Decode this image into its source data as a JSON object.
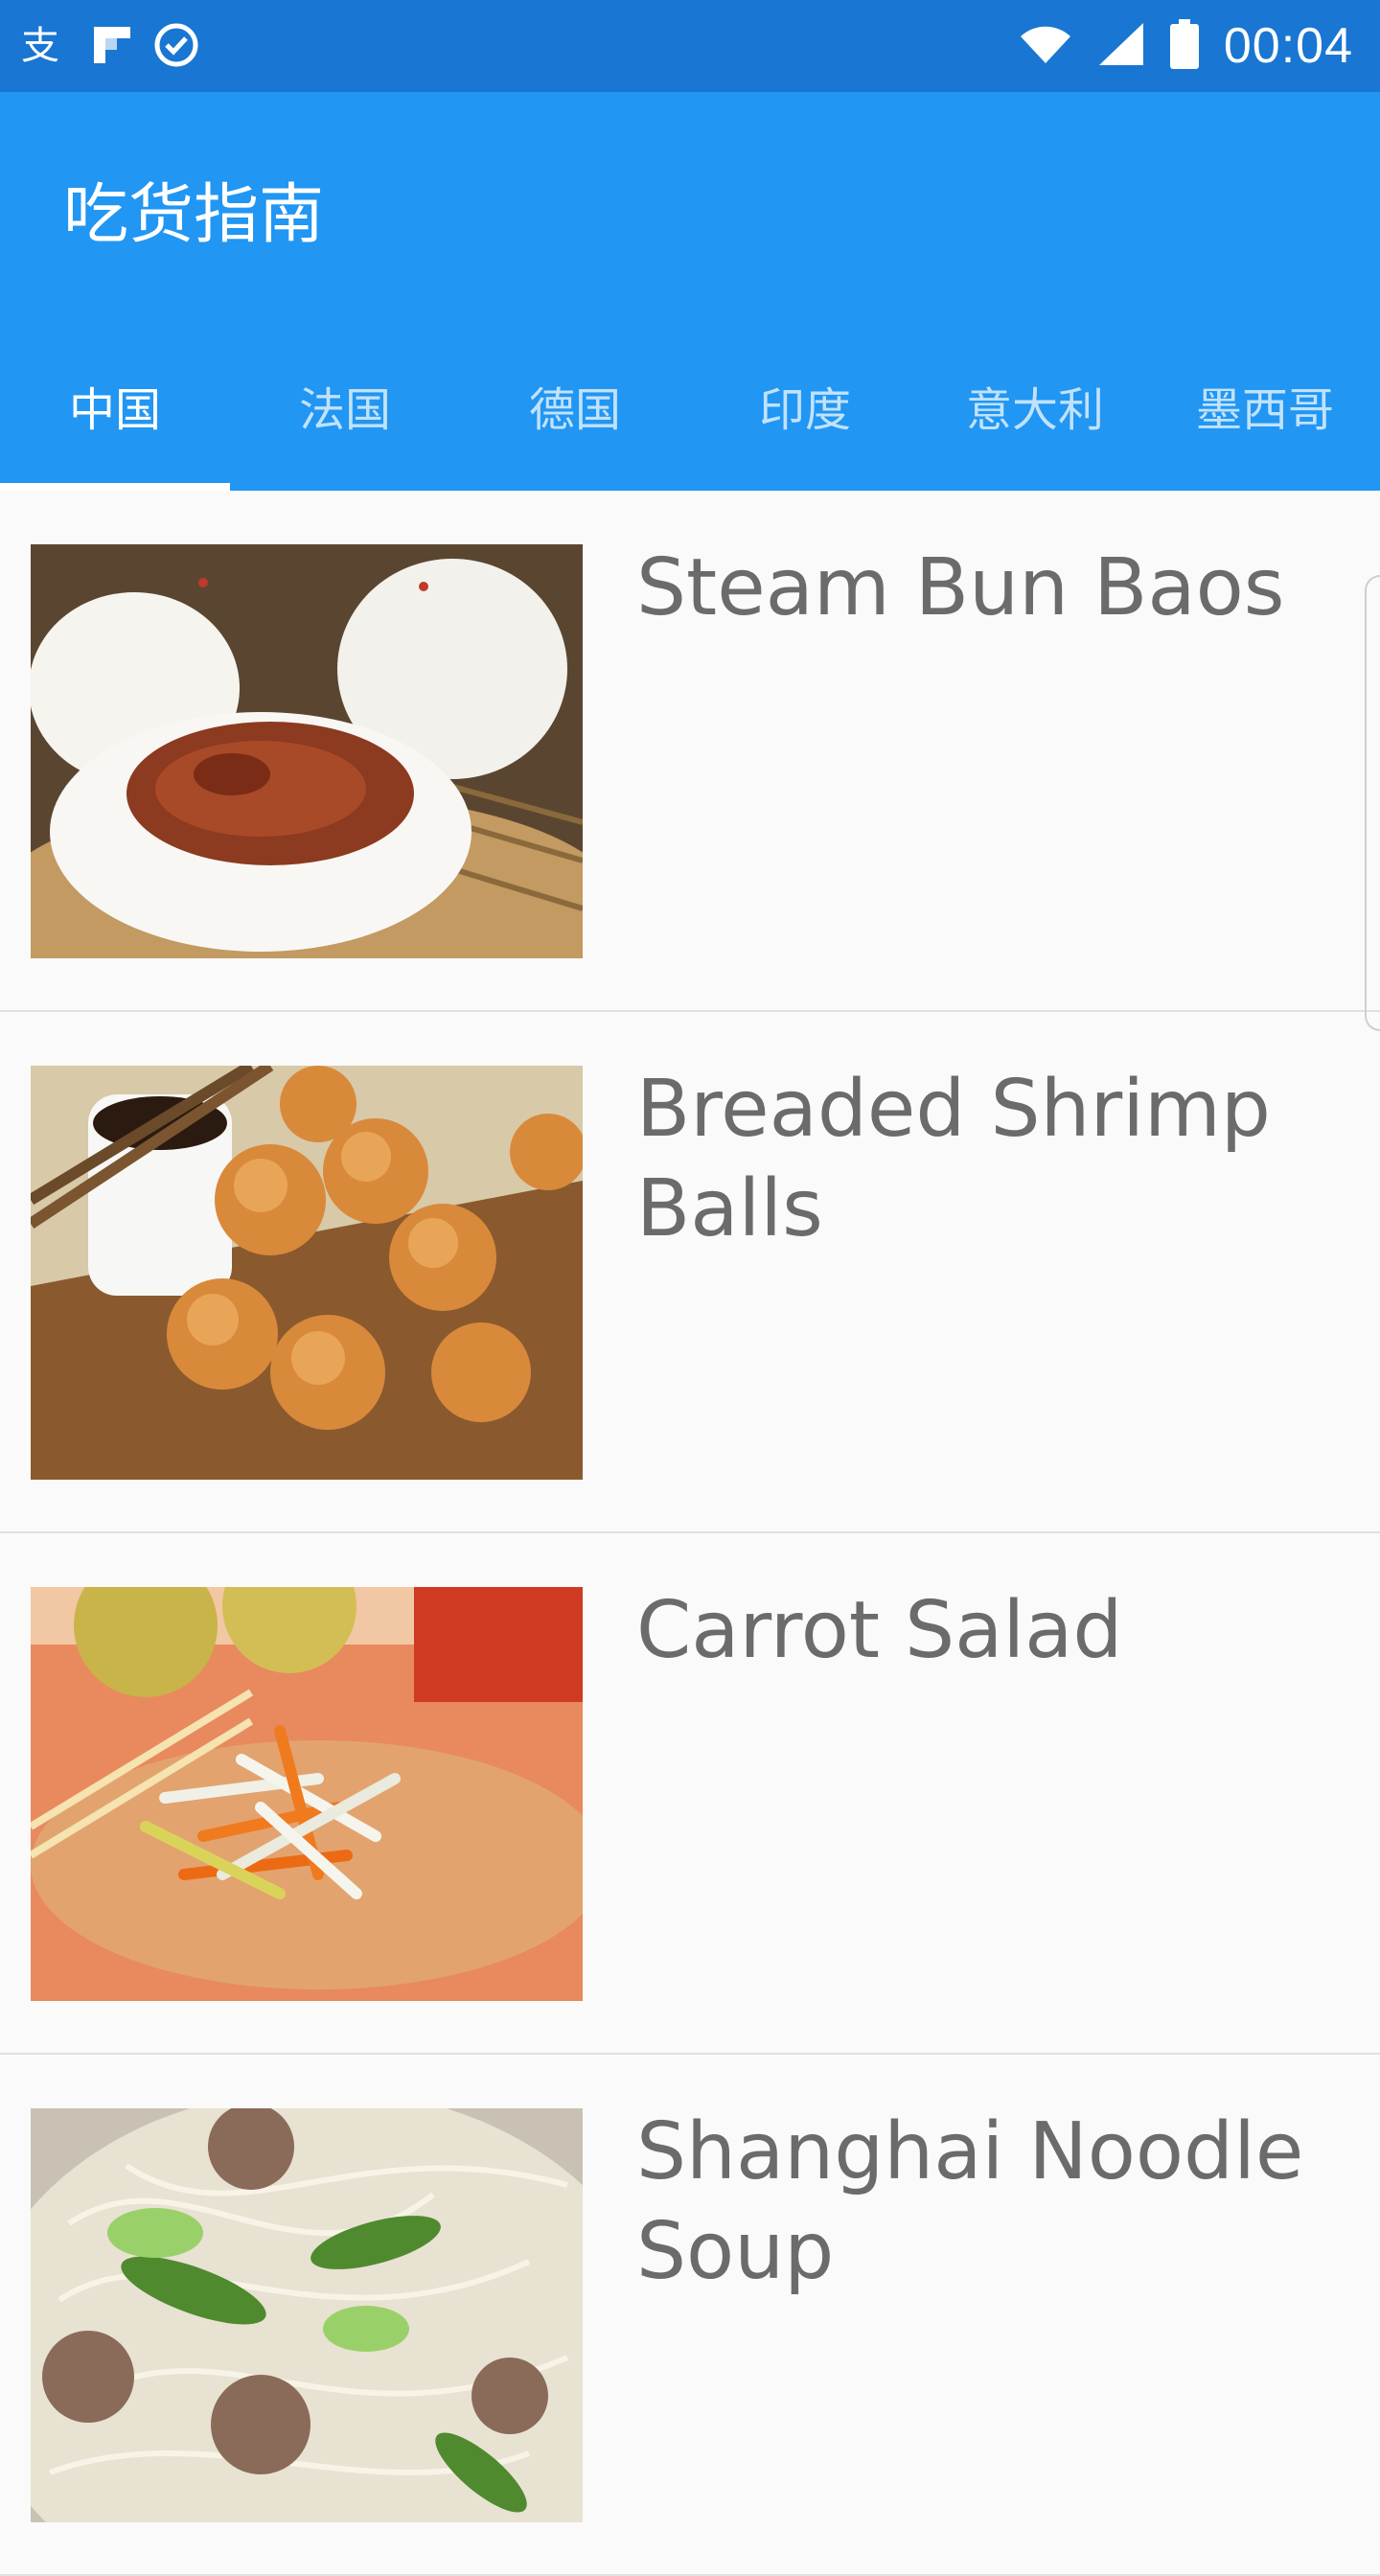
{
  "statusbar": {
    "time": "00:04",
    "left_icons": [
      "alipay-icon",
      "flipboard-icon",
      "check-circle-icon"
    ],
    "right_icons": [
      "wifi-icon",
      "cell-signal-icon",
      "battery-icon"
    ]
  },
  "appbar": {
    "title": "吃货指南",
    "color": "#2196f3",
    "status_color": "#1976d2"
  },
  "tabs": [
    {
      "label": "中国",
      "selected": true
    },
    {
      "label": "法国",
      "selected": false
    },
    {
      "label": "德国",
      "selected": false
    },
    {
      "label": "印度",
      "selected": false
    },
    {
      "label": "意大利",
      "selected": false
    },
    {
      "label": "墨西哥",
      "selected": false
    }
  ],
  "items": [
    {
      "title": "Steam Bun Baos",
      "image": "steam-bun-baos-photo"
    },
    {
      "title": "Breaded Shrimp Balls",
      "image": "breaded-shrimp-balls-photo"
    },
    {
      "title": "Carrot Salad",
      "image": "carrot-salad-photo"
    },
    {
      "title": "Shanghai Noodle Soup",
      "image": "shanghai-noodle-soup-photo"
    }
  ]
}
